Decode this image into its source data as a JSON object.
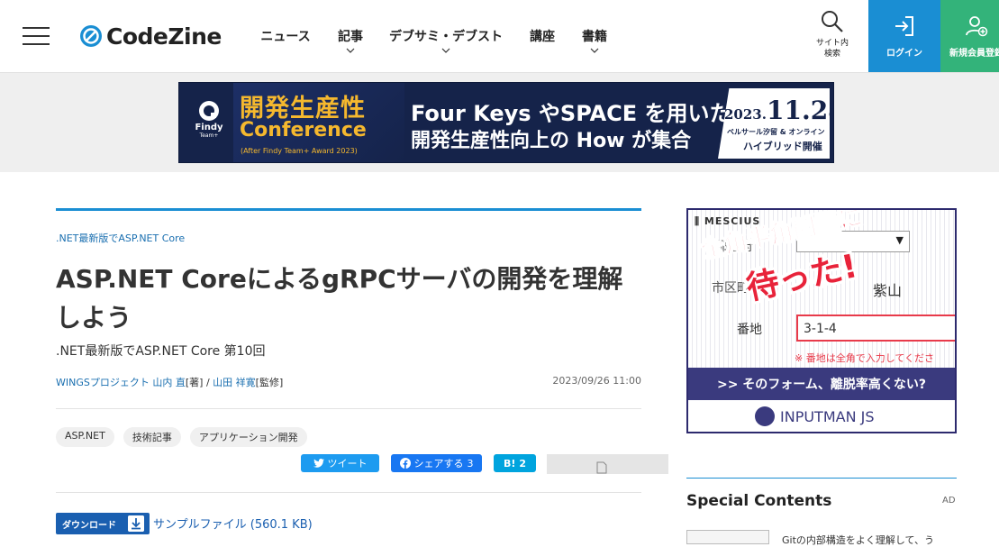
{
  "header": {
    "logo_text": "CodeZine",
    "nav": [
      {
        "label": "ニュース",
        "has_dropdown": false
      },
      {
        "label": "記事",
        "has_dropdown": true
      },
      {
        "label": "デブサミ・デブスト",
        "has_dropdown": true
      },
      {
        "label": "講座",
        "has_dropdown": false
      },
      {
        "label": "書籍",
        "has_dropdown": true
      }
    ],
    "search_label_line1": "サイト内",
    "search_label_line2": "検索",
    "login_label": "ログイン",
    "register_label": "新規会員登録",
    "colors": {
      "login": "#1a8ed3",
      "register": "#33b37a",
      "accent": "#1a8ed3"
    }
  },
  "banner": {
    "brand": "Findy",
    "brand_sub": "Team+",
    "title_line1": "開発生産性",
    "title_line2": "Conference",
    "title_line3": "(After Findy Team+ Award 2023)",
    "main_line1": "Four Keys やSPACE を用いた",
    "main_line2": "開発生産性向上の How が集合",
    "date_year": "2023.",
    "date_day": "11.28",
    "venue": "ベルサール汐留 & オンライン",
    "format": "ハイブリッド開催"
  },
  "article": {
    "category": ".NET最新版でASP.NET Core",
    "title": "ASP.NET CoreによるgRPCサーバの開発を理解しよう",
    "subtitle": ".NET最新版でASP.NET Core 第10回",
    "author1": "WINGSプロジェクト 山内 直",
    "author1_role": "[著] / ",
    "author2": "山田 祥寛",
    "author2_role": "[監修]",
    "date": "2023/09/26 11:00",
    "tags": [
      "ASP.NET",
      "技術記事",
      "アプリケーション開発"
    ],
    "share": {
      "tweet": "ツイート",
      "facebook": "シェアする",
      "facebook_count": "3",
      "hatena": "B!",
      "hatena_count": "2"
    },
    "download_label": "ダウンロード",
    "download_link": "サンプルファイル (560.1 KB)"
  },
  "sidebar": {
    "ad": {
      "brand": "MESCIUS",
      "label1": "都道府",
      "label2": "市区町",
      "addr_partial": "紫山",
      "label3": "番地",
      "input_value": "3-1-4",
      "note": "※ 番地は全角で入力してくださ",
      "headline1": "全角半角問題に",
      "headline2": "待った!",
      "cta": ">> そのフォーム、離脱率高くない?",
      "product": "INPUTMAN JS"
    },
    "special_contents_title": "Special Contents",
    "ad_label": "AD",
    "item1": "Gitの内部構造をよく理解して、う"
  }
}
